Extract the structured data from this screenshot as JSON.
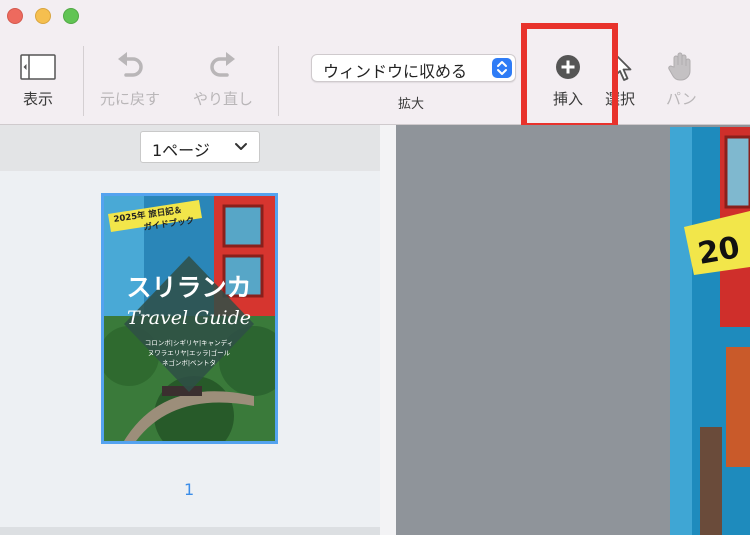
{
  "toolbar": {
    "view_label": "表示",
    "undo_label": "元に戻す",
    "redo_label": "やり直し",
    "zoom_value": "ウィンドウに収める",
    "zoom_caption": "拡大",
    "insert_label": "挿入",
    "select_label": "選択",
    "pan_label": "パン"
  },
  "sidebar": {
    "page_select": "1ページ",
    "page_number": "1",
    "thumbnail": {
      "badge_line1": "2025年 旅日記＆",
      "badge_line2": "ガイドブック",
      "title": "スリランカ",
      "subtitle": "Travel Guide",
      "places_1": "コロンボ|シギリヤ|キャンディ",
      "places_2": "ヌワラエリヤ|エッラ|ゴール",
      "places_3": "ネゴンボ|ベントタ"
    }
  },
  "viewer": {
    "badge_partial": "20"
  },
  "colors": {
    "highlight": "#e8322c",
    "accent": "#2f7cf6",
    "selection": "#54a3ef"
  }
}
